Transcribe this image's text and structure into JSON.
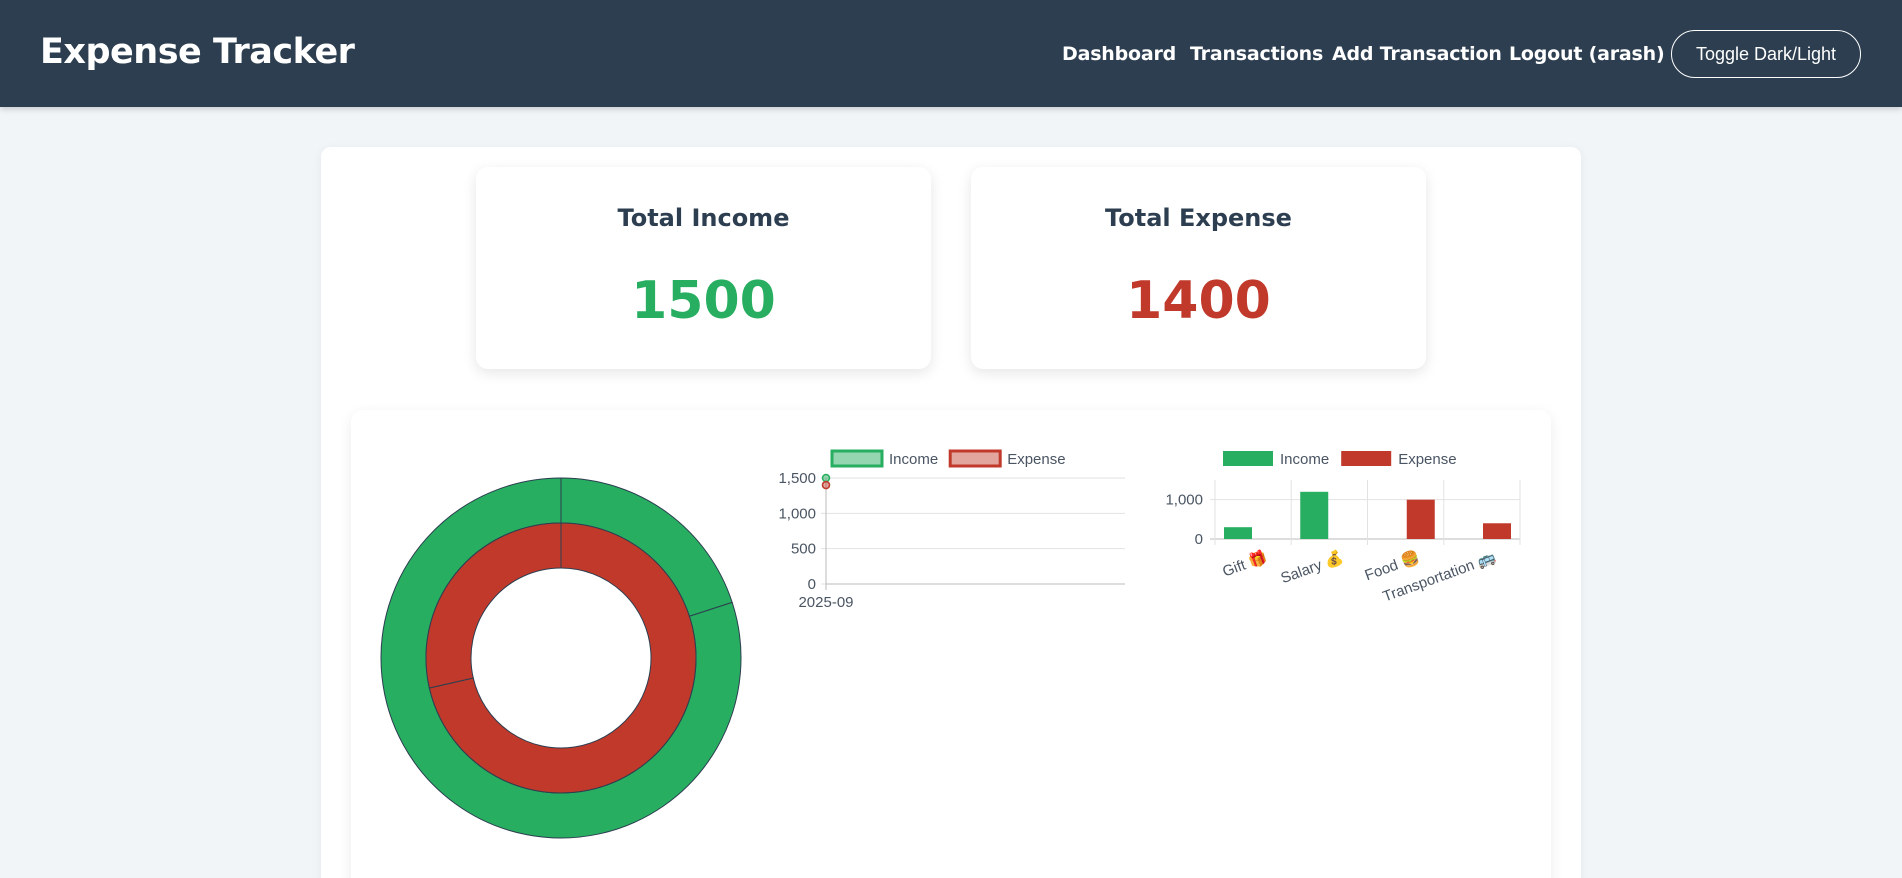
{
  "app": {
    "title": "Expense Tracker"
  },
  "nav": {
    "links": [
      {
        "label": "Dashboard"
      },
      {
        "label": "Transactions"
      },
      {
        "label": "Add Transaction"
      },
      {
        "label": "Logout (arash)"
      }
    ],
    "toggle_label": "Toggle Dark/Light"
  },
  "summary": {
    "income": {
      "title": "Total Income",
      "value": "1500",
      "color": "#27ae60"
    },
    "expense": {
      "title": "Total Expense",
      "value": "1400",
      "color": "#c0392b"
    }
  },
  "colors": {
    "income": "#27ae60",
    "expense": "#c0392b",
    "navbar": "#2c3e50"
  },
  "chart_data": [
    {
      "type": "pie",
      "variant": "doughnut",
      "title": "",
      "series": [
        {
          "name": "Income",
          "labels": [
            "Gift",
            "Salary"
          ],
          "values": [
            300,
            1200
          ]
        },
        {
          "name": "Expense",
          "labels": [
            "Food",
            "Transportation"
          ],
          "values": [
            1000,
            400
          ]
        }
      ]
    },
    {
      "type": "line",
      "title": "",
      "legend": "top",
      "categories": [
        "2025-09"
      ],
      "series": [
        {
          "name": "Income",
          "values": [
            1500
          ]
        },
        {
          "name": "Expense",
          "values": [
            1400
          ]
        }
      ],
      "ylim": [
        0,
        1500
      ],
      "y_ticks": [
        "0",
        "500",
        "1,000",
        "1,500"
      ],
      "grid": true
    },
    {
      "type": "bar",
      "title": "",
      "legend": "top",
      "categories": [
        "Gift 🎁",
        "Salary 💰",
        "Food 🍔",
        "Transportation 🚌"
      ],
      "series": [
        {
          "name": "Income",
          "values": [
            300,
            1200,
            0,
            0
          ]
        },
        {
          "name": "Expense",
          "values": [
            0,
            0,
            1000,
            400
          ]
        }
      ],
      "ylim": [
        0,
        1500
      ],
      "y_ticks": [
        "0",
        "1,000"
      ],
      "grid": true
    }
  ]
}
